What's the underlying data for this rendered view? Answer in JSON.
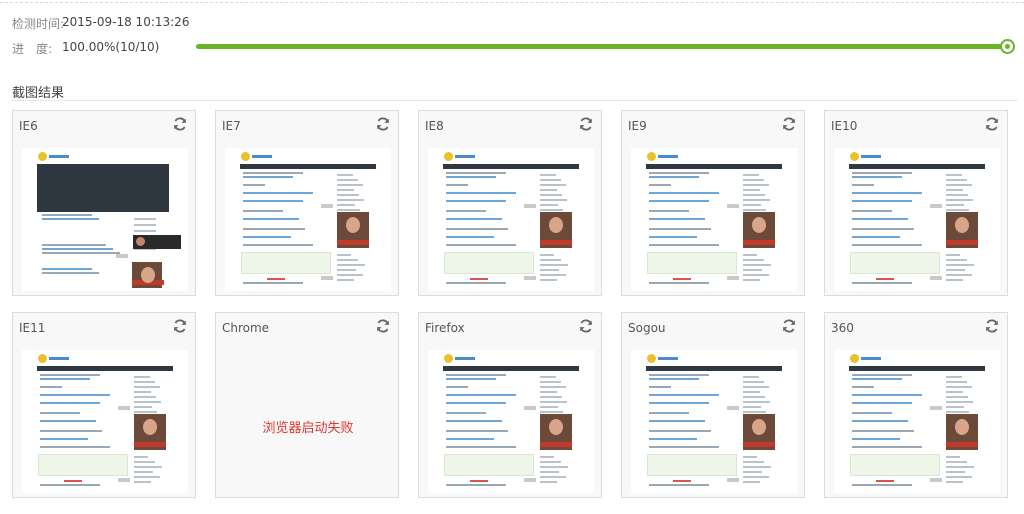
{
  "header": {
    "detect_time_label": "检测时间:",
    "detect_time_value": "2015-09-18 10:13:26",
    "progress_label": "进　度:",
    "progress_value": "100.00%(10/10)",
    "progress_fraction": 1.0
  },
  "section": {
    "title": "截图结果"
  },
  "browsers": [
    {
      "name": "IE6",
      "status": "ok",
      "variant": "ie6"
    },
    {
      "name": "IE7",
      "status": "ok",
      "variant": "normal"
    },
    {
      "name": "IE8",
      "status": "ok",
      "variant": "normal"
    },
    {
      "name": "IE9",
      "status": "ok",
      "variant": "normal"
    },
    {
      "name": "IE10",
      "status": "ok",
      "variant": "normal"
    },
    {
      "name": "IE11",
      "status": "ok",
      "variant": "normal"
    },
    {
      "name": "Chrome",
      "status": "failed",
      "message": "浏览器启动失败",
      "variant": "none"
    },
    {
      "name": "Firefox",
      "status": "ok",
      "variant": "normal"
    },
    {
      "name": "Sogou",
      "status": "ok",
      "variant": "normal"
    },
    {
      "name": "360",
      "status": "ok",
      "variant": "normal"
    }
  ],
  "colors": {
    "progress": "#6ab42a",
    "error": "#e0362b",
    "card_border": "#dcdcdc"
  },
  "icons": {
    "refresh": "refresh-icon"
  }
}
